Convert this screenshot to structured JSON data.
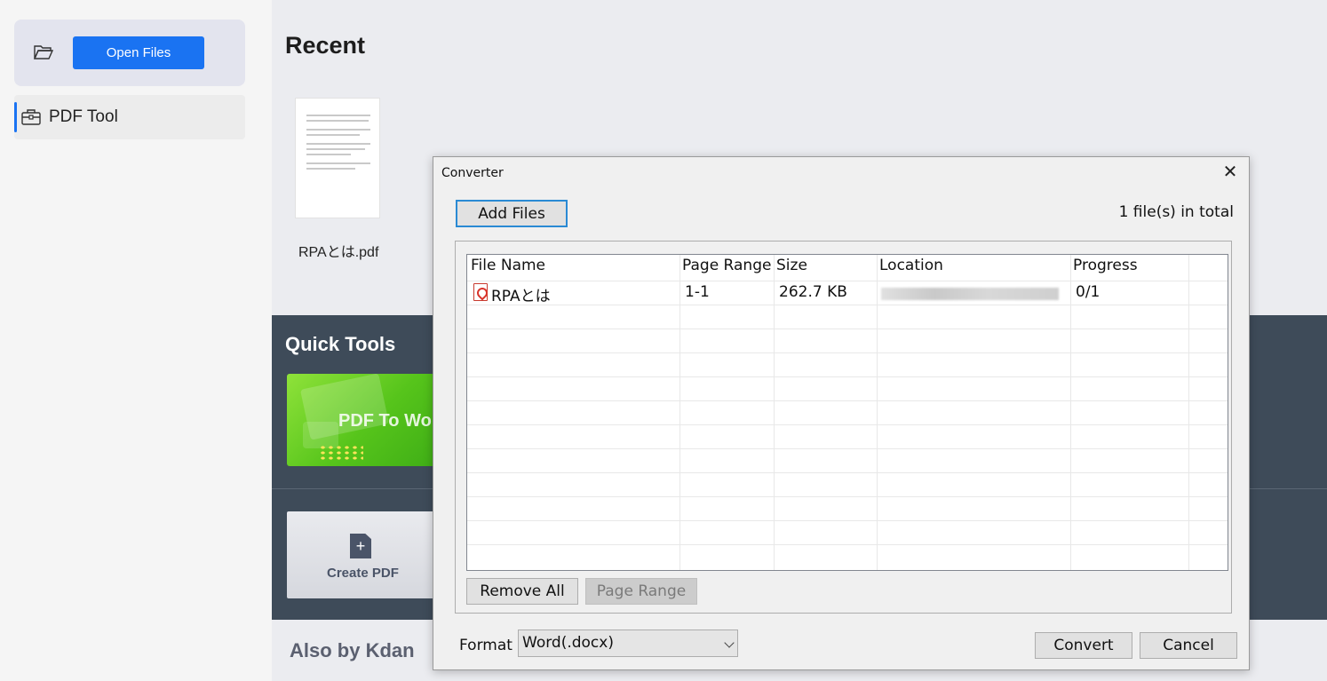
{
  "sidebar": {
    "open_files_label": "Open Files",
    "tool_label": "PDF Tool"
  },
  "main": {
    "recent_title": "Recent",
    "recent_file": "RPAとは.pdf",
    "quick_tools_title": "Quick Tools",
    "pdf_to_word_label": "PDF To Wo",
    "create_pdf_label": "Create PDF",
    "create_plus": "+",
    "also_title": "Also by Kdan"
  },
  "dialog": {
    "title": "Converter",
    "close_glyph": "✕",
    "add_files_label": "Add Files",
    "total_text": "1 file(s) in total",
    "columns": [
      "File Name",
      "Page Range",
      "Size",
      "Location",
      "Progress"
    ],
    "rows": [
      {
        "file_name": "RPAとは",
        "page_range": "1-1",
        "size": "262.7 KB",
        "location": "",
        "progress": "0/1"
      }
    ],
    "remove_all_label": "Remove All",
    "page_range_label": "Page Range",
    "format_label": "Format",
    "format_value": "Word(.docx)",
    "convert_label": "Convert",
    "cancel_label": "Cancel"
  },
  "colors": {
    "accent": "#1a73f2",
    "dark_band": "#3e4b59",
    "pdf_red": "#d9342b"
  }
}
